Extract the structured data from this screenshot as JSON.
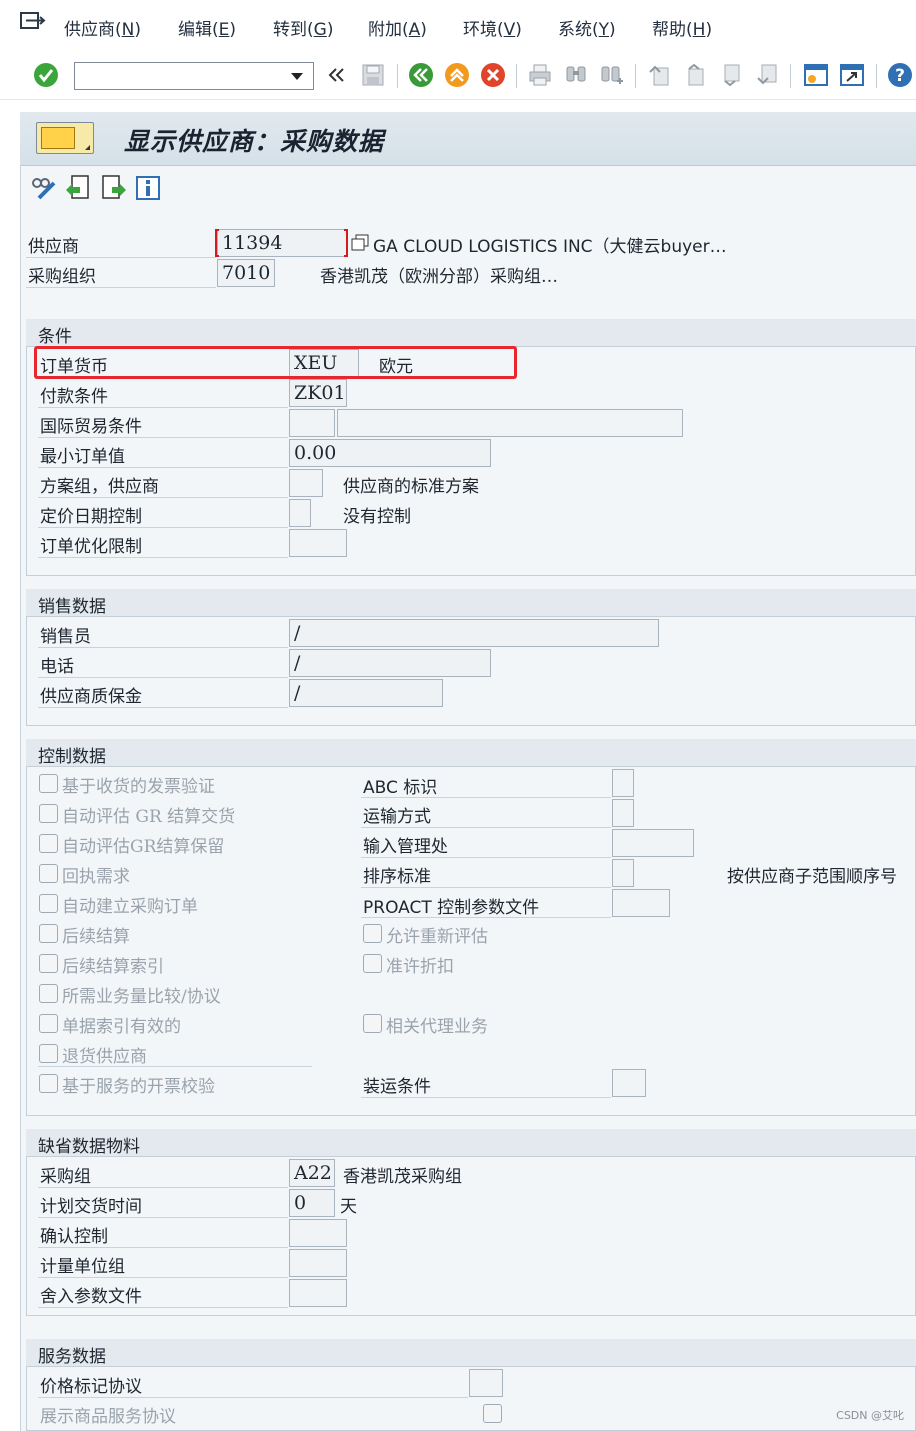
{
  "menu": {
    "items": [
      {
        "text": "供应商(",
        "key": "N",
        "close": ")"
      },
      {
        "text": "编辑(",
        "key": "E",
        "close": ")"
      },
      {
        "text": "转到(",
        "key": "G",
        "close": ")"
      },
      {
        "text": "附加(",
        "key": "A",
        "close": ")"
      },
      {
        "text": "环境(",
        "key": "V",
        "close": ")"
      },
      {
        "text": "系统(",
        "key": "Y",
        "close": ")"
      },
      {
        "text": "帮助(",
        "key": "H",
        "close": ")"
      }
    ]
  },
  "toolbar": {
    "command_value": "",
    "icons": [
      "enter-icon",
      "command-field",
      "back-double-icon",
      "save-icon",
      "back-icon",
      "exit-icon",
      "cancel-icon",
      "print-icon",
      "find-icon",
      "find-next-icon",
      "first-page-icon",
      "prev-page-icon",
      "next-page-icon",
      "last-page-icon",
      "new-session-icon",
      "shortcut-icon",
      "help-icon"
    ]
  },
  "page": {
    "title": "显示供应商：采购数据"
  },
  "header": {
    "vendor_label": "供应商",
    "vendor_value": "11394",
    "vendor_name": "GA CLOUD LOGISTICS INC（大健云buyer…",
    "purch_org_label": "采购组织",
    "purch_org_value": "7010",
    "purch_org_name": "香港凯茂（欧洲分部）采购组…"
  },
  "conditions": {
    "title": "条件",
    "order_currency_label": "订单货币",
    "order_currency_value": "XEU",
    "order_currency_text": "欧元",
    "payment_terms_label": "付款条件",
    "payment_terms_value": "ZK01",
    "incoterms_label": "国际贸易条件",
    "incoterms_value": "",
    "incoterms_location": "",
    "min_order_label": "最小订单值",
    "min_order_value": "0.00",
    "schema_group_label": "方案组，供应商",
    "schema_group_value": "",
    "schema_group_text": "供应商的标准方案",
    "pricing_date_label": "定价日期控制",
    "pricing_date_value": "",
    "pricing_date_text": "没有控制",
    "order_opt_label": "订单优化限制",
    "order_opt_value": ""
  },
  "sales": {
    "title": "销售数据",
    "salesperson_label": "销售员",
    "salesperson_value": "/",
    "phone_label": "电话",
    "phone_value": "/",
    "warranty_label": "供应商质保金",
    "warranty_value": "/"
  },
  "control": {
    "title": "控制数据",
    "checkboxes_left": [
      "基于收货的发票验证",
      "自动评估 GR 结算交货",
      "自动评估GR结算保留",
      "回执需求",
      "自动建立采购订单",
      "后续结算",
      "后续结算索引",
      "所需业务量比较/协议",
      "单据索引有效的",
      "退货供应商",
      "基于服务的开票校验"
    ],
    "abc_label": "ABC 标识",
    "abc_value": "",
    "transport_label": "运输方式",
    "transport_value": "",
    "entry_office_label": "输入管理处",
    "entry_office_value": "",
    "sort_label": "排序标准",
    "sort_value": "",
    "sort_text": "按供应商子范围顺序号",
    "proact_label": "PROACT 控制参数文件",
    "proact_value": "",
    "reeval_label": "允许重新评估",
    "discount_label": "准许折扣",
    "agency_label": "相关代理业务",
    "shipping_label": "装运条件",
    "shipping_value": ""
  },
  "default_material": {
    "title": "缺省数据物料",
    "purch_group_label": "采购组",
    "purch_group_value": "A22",
    "purch_group_text": "香港凯茂采购组",
    "delivery_time_label": "计划交货时间",
    "delivery_time_value": "0",
    "delivery_time_unit": "天",
    "confirm_label": "确认控制",
    "confirm_value": "",
    "uom_label": "计量单位组",
    "uom_value": "",
    "rounding_label": "舍入参数文件",
    "rounding_value": ""
  },
  "service": {
    "title": "服务数据",
    "price_marking_label": "价格标记协议",
    "price_marking_value": "",
    "rack_jobbing_label": "展示商品服务协议"
  },
  "watermark": "CSDN @艾叱"
}
